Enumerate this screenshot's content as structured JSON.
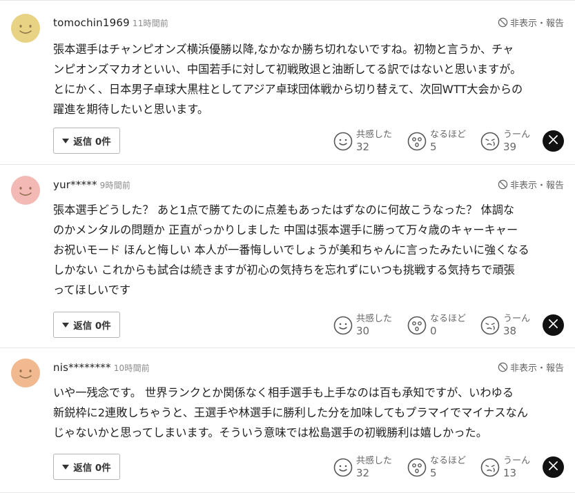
{
  "labels": {
    "hide_report": "非表示・報告",
    "reply_prefix": "返信",
    "reaction_empathy": "共感した",
    "reaction_insight": "なるほど",
    "reaction_hmm": "うーん"
  },
  "comments": [
    {
      "username": "tomochin1969",
      "time": "11時間前",
      "avatar_color": "#e8d283",
      "text": "張本選手はチャンピオンズ横浜優勝以降,なかなか勝ち切れないですね。初物と言うか、チャ\nンピオンズマカオといい、中国若手に対して初戦敗退と油断してる訳ではないと思いますが。\nとにかく、日本男子卓球大黒柱としてアジア卓球団体戦から切り替えて、次回WTT大会からの\n躍進を期待したいと思います。",
      "reply_label": "返信 0件",
      "empathy_count": "32",
      "insight_count": "5",
      "hmm_count": "39"
    },
    {
      "username": "yur*****",
      "time": "9時間前",
      "avatar_color": "#f3b9b4",
      "text": "張本選手どうした？ あと1点で勝てたのに点差もあったはずなのに何故こうなった？ 体調な\nのかメンタルの問題か 正直がっかりしました 中国は張本選手に勝って万々歳のキャーキャー\nお祝いモード ほんと悔しい 本人が一番悔しいでしょうが美和ちゃんに言ったみたいに強くなる\nしかない これからも試合は続きますが初心の気持ちを忘れずにいつも挑戦する気持ちで頑張\nってほしいです",
      "reply_label": "返信 0件",
      "empathy_count": "30",
      "insight_count": "0",
      "hmm_count": "38"
    },
    {
      "username": "nis********",
      "time": "10時間前",
      "avatar_color": "#f1b990",
      "text": "いや一残念です。 世界ランクとか関係なく相手選手も上手なのは百も承知ですが、いわゆる\n新鋭枠に2連敗しちゃうと、王選手や林選手に勝利した分を加味してもプラマイでマイナスなん\nじゃないかと思ってしまいます。そういう意味では松島選手の初戦勝利は嬉しかった。",
      "reply_label": "返信 0件",
      "empathy_count": "32",
      "insight_count": "5",
      "hmm_count": "13"
    }
  ]
}
